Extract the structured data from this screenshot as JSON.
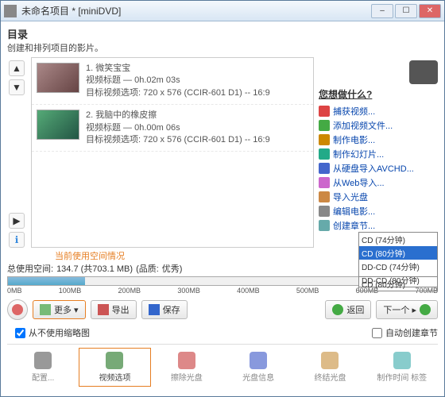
{
  "window": {
    "title": "未命名项目 * [miniDVD]",
    "min": "–",
    "max": "☐",
    "close": "✕"
  },
  "section": {
    "title": "目录",
    "sub": "创建和排列项目的影片。"
  },
  "leftcol": {
    "prev": "▲",
    "next": "▼",
    "play": "▶",
    "info": "ℹ"
  },
  "clips": [
    {
      "title": "1. 微笑宝宝",
      "meta1": "视频标题 — 0h.02m 03s",
      "meta2": "目标视频选项: 720 x 576 (CCIR-601 D1) -- 16:9"
    },
    {
      "title": "2. 我脑中的橡皮擦",
      "meta1": "视频标题 — 0h.00m 06s",
      "meta2": "目标视频选项: 720 x 576 (CCIR-601 D1) -- 16:9"
    }
  ],
  "sidepanel": {
    "heading": "您想做什么?",
    "items": [
      {
        "label": "捕获视频...",
        "c": "#d44"
      },
      {
        "label": "添加视频文件...",
        "c": "#4a4"
      },
      {
        "label": "制作电影...",
        "c": "#c80"
      },
      {
        "label": "制作幻灯片...",
        "c": "#2a8"
      },
      {
        "label": "从硬盘导入AVCHD...",
        "c": "#46c"
      },
      {
        "label": "从Web导入...",
        "c": "#c6c"
      },
      {
        "label": "导入光盘",
        "c": "#c84"
      },
      {
        "label": "编辑电影...",
        "c": "#888"
      },
      {
        "label": "创建章节...",
        "c": "#6aa"
      }
    ]
  },
  "storage": {
    "annot": "当前使用空间情况",
    "label": "总使用空间:",
    "value": "134.7 (共703.1 MB)",
    "quality_l": "(品质:",
    "quality_v": "优秀)",
    "ticks": [
      "0MB",
      "100MB",
      "200MB",
      "300MB",
      "400MB",
      "500MB",
      "600MB",
      "700MB"
    ],
    "dropdown": {
      "options": [
        "CD (74分钟)",
        "CD (80分钟)",
        "DD-CD (74分钟)",
        "DD-CD (80分钟)"
      ],
      "selected": "CD (80分钟)"
    }
  },
  "toolbar": {
    "back": "",
    "more": "更多 ▾",
    "export": "导出",
    "save": "保存",
    "ret": "返回",
    "next": "下一个 ▸"
  },
  "checks": {
    "thumb": "从不使用缩略图",
    "chapter": "自动创建章节"
  },
  "bottom": [
    {
      "label": "配置...",
      "c": "#999"
    },
    {
      "label": "视频选项",
      "c": "#7a7",
      "active": true
    },
    {
      "label": "擦除光盘",
      "c": "#d88"
    },
    {
      "label": "光盘信息",
      "c": "#89d"
    },
    {
      "label": "终结光盘",
      "c": "#db8"
    },
    {
      "label": "制作时间 标签",
      "c": "#8cc"
    }
  ]
}
